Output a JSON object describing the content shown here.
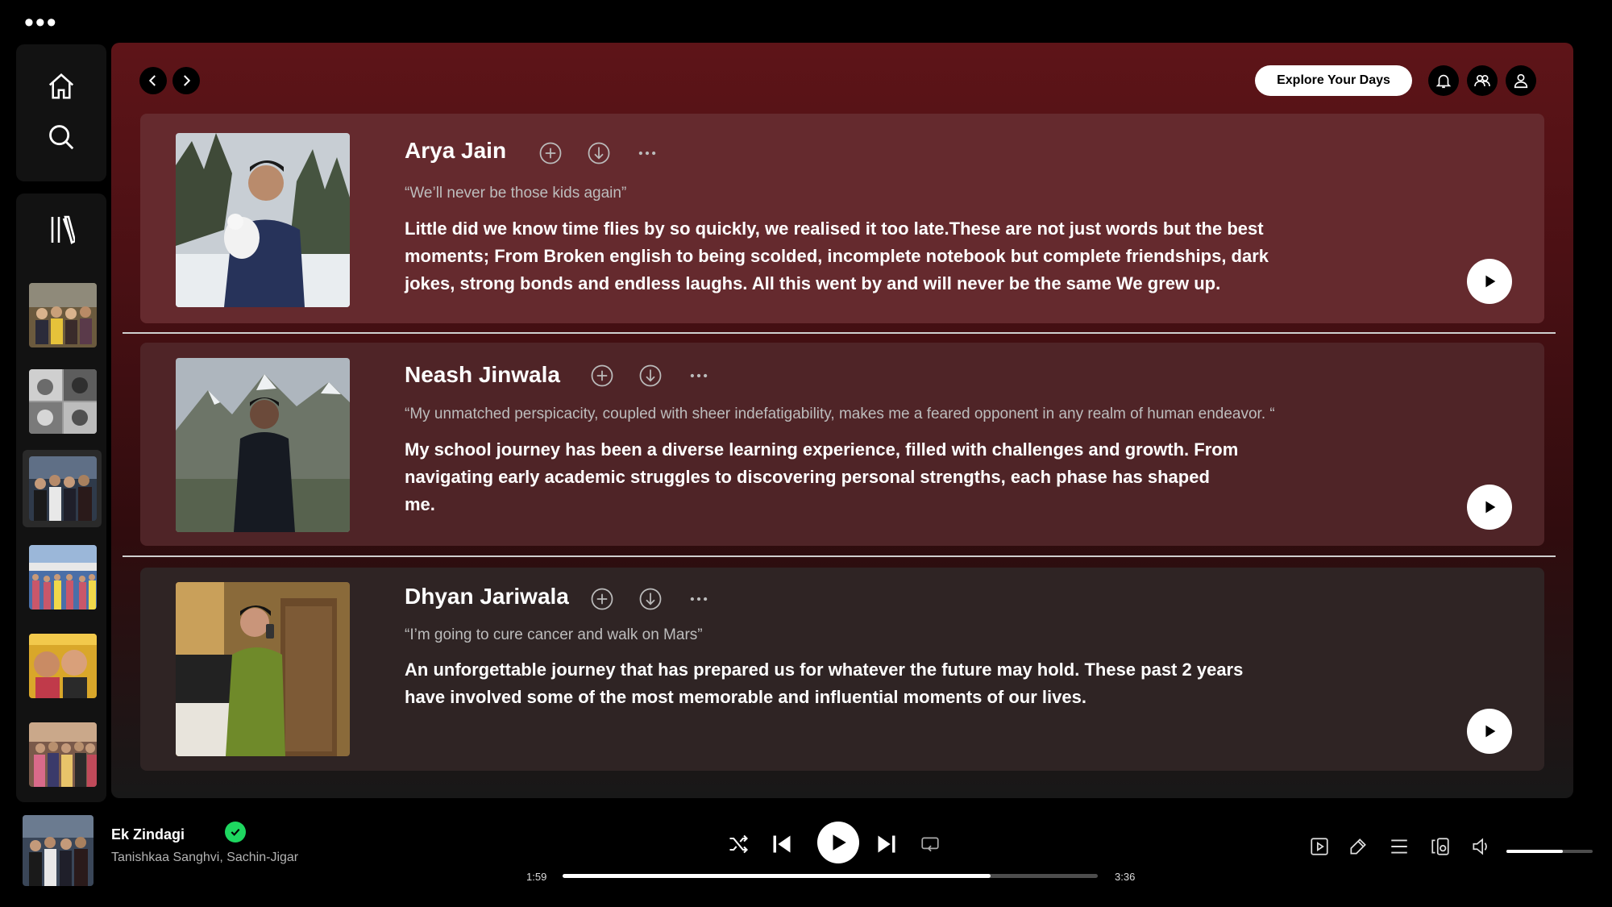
{
  "app": {
    "menu_icon": "more-horizontal-icon",
    "accent_color": "#1ed760",
    "header_gradient_top": "#5e1418"
  },
  "sidebar": {
    "home_icon": "home-icon",
    "search_icon": "search-icon",
    "library_icon": "library-icon",
    "playlists": [
      {
        "name": "playlist-thumb-1",
        "selected": false
      },
      {
        "name": "playlist-thumb-2",
        "selected": false
      },
      {
        "name": "playlist-thumb-3",
        "selected": true
      },
      {
        "name": "playlist-thumb-4",
        "selected": false
      },
      {
        "name": "playlist-thumb-5",
        "selected": false
      },
      {
        "name": "playlist-thumb-6",
        "selected": false
      }
    ]
  },
  "header": {
    "explore_label": "Explore Your Days",
    "icons": [
      "bell-icon",
      "friends-icon",
      "user-icon"
    ]
  },
  "cards": [
    {
      "name": "Arya Jain",
      "quote": "“We’ll never be those kids again”",
      "body": "Little did we know time flies by so quickly, we realised it too late.These are not just words but the best moments; From Broken english to being scolded, incomplete notebook but complete friendships, dark jokes, strong bonds and endless laughs. All this went by and will never be the same We grew up."
    },
    {
      "name": "Neash Jinwala",
      "quote": "“My unmatched perspicacity, coupled with sheer indefatigability, makes me a feared opponent in any realm of human endeavor. “",
      "body": "My school journey has been a diverse learning experience, filled with challenges and growth. From navigating early academic struggles to discovering personal strengths, each phase has shaped me."
    },
    {
      "name": "Dhyan Jariwala",
      "quote": "“I’m going to cure cancer and walk on Mars”",
      "body": "An unforgettable journey that has prepared us for whatever the future may hold. These past 2 years have involved some of the most memorable and influential moments of our lives."
    }
  ],
  "player": {
    "track": "Ek Zindagi",
    "artist": "Tanishkaa Sanghvi, Sachin-Jigar",
    "elapsed": "1:59",
    "duration": "3:36",
    "progress": 0.8,
    "volume": 0.65,
    "liked_icon": "check-circle-icon"
  }
}
